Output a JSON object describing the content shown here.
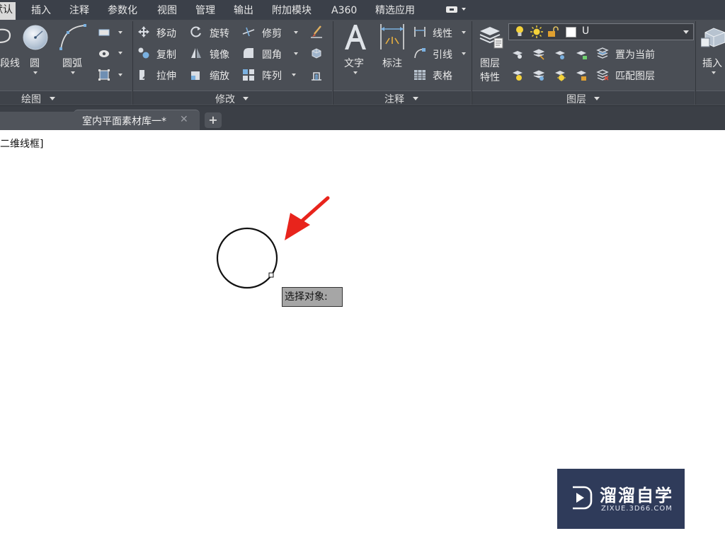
{
  "menu": {
    "tabs": [
      "默认",
      "插入",
      "注释",
      "参数化",
      "视图",
      "管理",
      "输出",
      "附加模块",
      "A360",
      "精选应用"
    ],
    "quick_access_icon": "camera-dropdown-icon"
  },
  "ribbon": {
    "draw": {
      "title": "绘图",
      "polyline_label": "段线",
      "circle_label": "圆",
      "arc_label": "圆弧"
    },
    "modify": {
      "title": "修改",
      "move": "移动",
      "rotate": "旋转",
      "trim": "修剪",
      "copy": "复制",
      "mirror": "镜像",
      "fillet": "圆角",
      "stretch": "拉伸",
      "scale": "缩放",
      "array": "阵列"
    },
    "annotation": {
      "title": "注释",
      "text": "文字",
      "dimension": "标注",
      "linear": "线性",
      "leader": "引线",
      "table": "表格"
    },
    "layers": {
      "title": "图层",
      "properties_line1": "图层",
      "properties_line2": "特性",
      "current_layer": "U",
      "set_current": "置为当前",
      "match_layer": "匹配图层"
    },
    "block": {
      "insert": "插入"
    }
  },
  "file_tabs": {
    "active_file": "室内平面素材库一*",
    "close_glyph": "✕",
    "add_glyph": "+"
  },
  "canvas": {
    "viewport_label": "二维线框]",
    "prompt_tooltip": "选择对象:",
    "colors": {
      "arrow": "#e8241c",
      "circle": "#111111"
    }
  },
  "watermark": {
    "title": "溜溜自学",
    "url": "ZIXUE.3D66.COM"
  }
}
